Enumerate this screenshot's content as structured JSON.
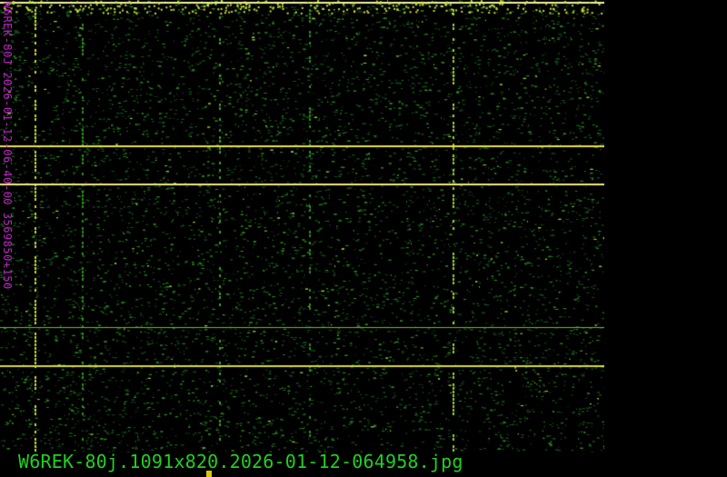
{
  "spectrogram": {
    "side_label": "W6REK-80J 2026-01-12-06-40-00 3569850+150",
    "caption": "W6REK-80j.1091x820.2026-01-12-064958.jpg",
    "colors": {
      "background": "#000000",
      "noise": "#1f8a1f",
      "signal": "#e0e040",
      "label": "#c020c8",
      "caption": "#20d020",
      "marker": "#d8c800"
    }
  }
}
